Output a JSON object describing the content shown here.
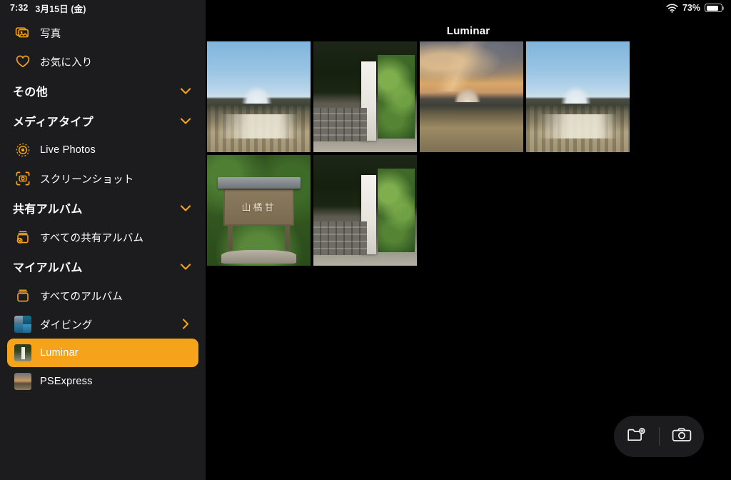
{
  "statusbar": {
    "time": "7:32",
    "date": "3月15日 (金)",
    "battery_percent": "73%",
    "wifi_icon": "wifi-icon",
    "battery_icon": "battery-icon"
  },
  "sidebar": {
    "items": [
      {
        "type": "item",
        "label": "写真",
        "icon": "photos-icon",
        "name": "sidebar-item-photos"
      },
      {
        "type": "item",
        "label": "お気に入り",
        "icon": "heart-icon",
        "name": "sidebar-item-favorites"
      },
      {
        "type": "section",
        "label": "その他",
        "icon": "chevron-down-icon",
        "name": "sidebar-section-other"
      },
      {
        "type": "section",
        "label": "メディアタイプ",
        "icon": "chevron-down-icon",
        "name": "sidebar-section-media-types"
      },
      {
        "type": "item",
        "label": "Live Photos",
        "icon": "live-photos-icon",
        "name": "sidebar-item-live-photos"
      },
      {
        "type": "item",
        "label": "スクリーンショット",
        "icon": "screenshot-icon",
        "name": "sidebar-item-screenshots"
      },
      {
        "type": "section",
        "label": "共有アルバム",
        "icon": "chevron-down-icon",
        "name": "sidebar-section-shared-albums"
      },
      {
        "type": "item",
        "label": "すべての共有アルバム",
        "icon": "shared-album-icon",
        "name": "sidebar-item-all-shared-albums"
      },
      {
        "type": "section",
        "label": "マイアルバム",
        "icon": "chevron-down-icon",
        "name": "sidebar-section-my-albums"
      },
      {
        "type": "item",
        "label": "すべてのアルバム",
        "icon": "album-icon",
        "name": "sidebar-item-all-albums"
      },
      {
        "type": "album",
        "label": "ダイビング",
        "icon": "album-thumbnail",
        "name": "sidebar-item-diving",
        "thumb": "dive",
        "chevron": "chevron-right-icon"
      },
      {
        "type": "album",
        "label": "Luminar",
        "icon": "album-thumbnail",
        "name": "sidebar-item-luminar",
        "thumb": "lum",
        "selected": true
      },
      {
        "type": "album",
        "label": "PSExpress",
        "icon": "album-thumbnail",
        "name": "sidebar-item-psexpress",
        "thumb": "pse"
      }
    ],
    "selected_label": "Luminar",
    "accent_color": "#f5a31a",
    "background_color": "#1c1c1e"
  },
  "main": {
    "title": "Luminar",
    "photos": [
      {
        "name": "photo-mount-fuji-daylight-town",
        "art": "fuji-day",
        "alt": "富士山と街並み（昼）"
      },
      {
        "name": "photo-stone-monument-garden",
        "art": "garden",
        "alt": "石碑と石垣の庭"
      },
      {
        "name": "photo-mount-fuji-sunset-clouds",
        "art": "fuji-sunset",
        "alt": "夕焼けの富士山と雲"
      },
      {
        "name": "photo-mount-fuji-blue-sky-town",
        "art": "fuji-day",
        "alt": "青空の富士山と街並み"
      },
      {
        "name": "photo-wooden-shrine-sign",
        "art": "shrine",
        "alt": "木製の社号標",
        "sign_text": "山橘甘"
      },
      {
        "name": "photo-stone-monument-garden-2",
        "art": "garden",
        "alt": "石碑と石垣の庭 2"
      }
    ],
    "photo_count": 6,
    "background_color": "#000000"
  },
  "fab": {
    "new_album_label": "新規アルバム",
    "new_album_icon": "folder-plus-icon",
    "camera_label": "カメラ",
    "camera_icon": "camera-icon",
    "background_color": "#1c1c1e"
  }
}
